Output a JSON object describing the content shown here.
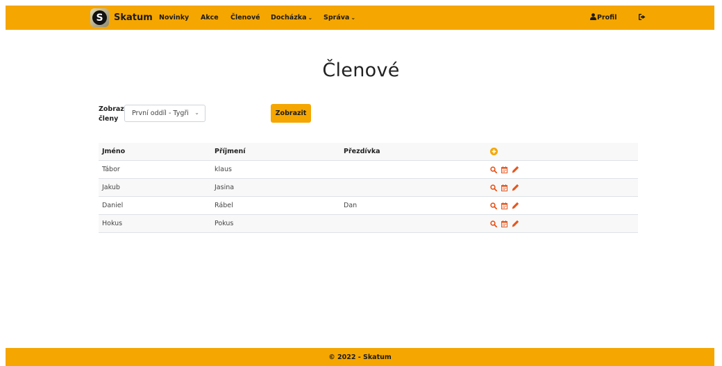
{
  "brand": {
    "logo_letter": "S",
    "name": "Skatum"
  },
  "nav": {
    "items": [
      {
        "label": "Novinky"
      },
      {
        "label": "Akce"
      },
      {
        "label": "Členové"
      },
      {
        "label": "Docházka"
      },
      {
        "label": "Správa"
      }
    ],
    "profile_label": "Profil"
  },
  "page": {
    "title": "Členové"
  },
  "filter": {
    "label_line1": "Zobrazit",
    "label_line2": "členy",
    "selected": "První oddíl - Tygři",
    "button_label": "Zobrazit"
  },
  "table": {
    "headers": [
      "Jméno",
      "Příjmení",
      "Přezdívka"
    ],
    "rows": [
      {
        "jmeno": "Tábor",
        "prijmeni": "klaus",
        "prezdivka": ""
      },
      {
        "jmeno": "Jakub",
        "prijmeni": "Jasina",
        "prezdivka": ""
      },
      {
        "jmeno": "Daniel",
        "prijmeni": "Rábel",
        "prezdivka": "Dan"
      },
      {
        "jmeno": "Hokus",
        "prijmeni": "Pokus",
        "prezdivka": ""
      }
    ],
    "row_icons": [
      "search-icon",
      "calendar-icon",
      "pencil-icon"
    ],
    "header_icon": "plus-circle-icon"
  },
  "footer": {
    "text": "© 2022 - Skatum"
  },
  "colors": {
    "accent": "#f5a600",
    "icon": "#e8541b",
    "add_icon": "#f5a600"
  }
}
